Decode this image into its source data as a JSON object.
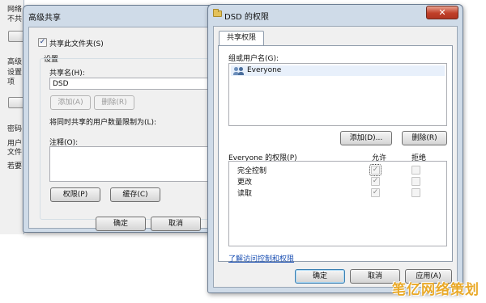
{
  "background_window": {
    "fragments": [
      "网络",
      "不共",
      "共",
      "高级",
      "设置",
      "项",
      "密码",
      "用户",
      "文件",
      "若要"
    ]
  },
  "advanced_sharing": {
    "title": "高级共享",
    "share_checkbox_label": "共享此文件夹(S)",
    "share_checked": true,
    "settings_label": "设置",
    "share_name_label": "共享名(H):",
    "share_name_value": "DSD",
    "add_button": "添加(A)",
    "remove_button": "删除(R)",
    "user_limit_label": "将同时共享的用户数量限制为(L):",
    "comments_label": "注释(O):",
    "permissions_button": "权限(P)",
    "caching_button": "缓存(C)",
    "ok_button": "确定",
    "cancel_button": "取消"
  },
  "permissions": {
    "title": "DSD 的权限",
    "close_glyph": "✕",
    "tab_label": "共享权限",
    "group_label": "组或用户名(G):",
    "users": [
      "Everyone"
    ],
    "add_button": "添加(D)...",
    "remove_button": "删除(R)",
    "perm_header": "Everyone 的权限(P)",
    "allow_header": "允许",
    "deny_header": "拒绝",
    "rows": [
      {
        "name": "完全控制",
        "allow": true,
        "deny": false
      },
      {
        "name": "更改",
        "allow": true,
        "deny": false
      },
      {
        "name": "读取",
        "allow": true,
        "deny": false
      }
    ],
    "learn_link": "了解访问控制和权限",
    "ok_button": "确定",
    "cancel_button": "取消",
    "apply_button": "应用(A)"
  },
  "watermark": "笔亿网络策划",
  "icons": {
    "folder": "folder-icon",
    "users": "users-icon",
    "check": "✓"
  }
}
